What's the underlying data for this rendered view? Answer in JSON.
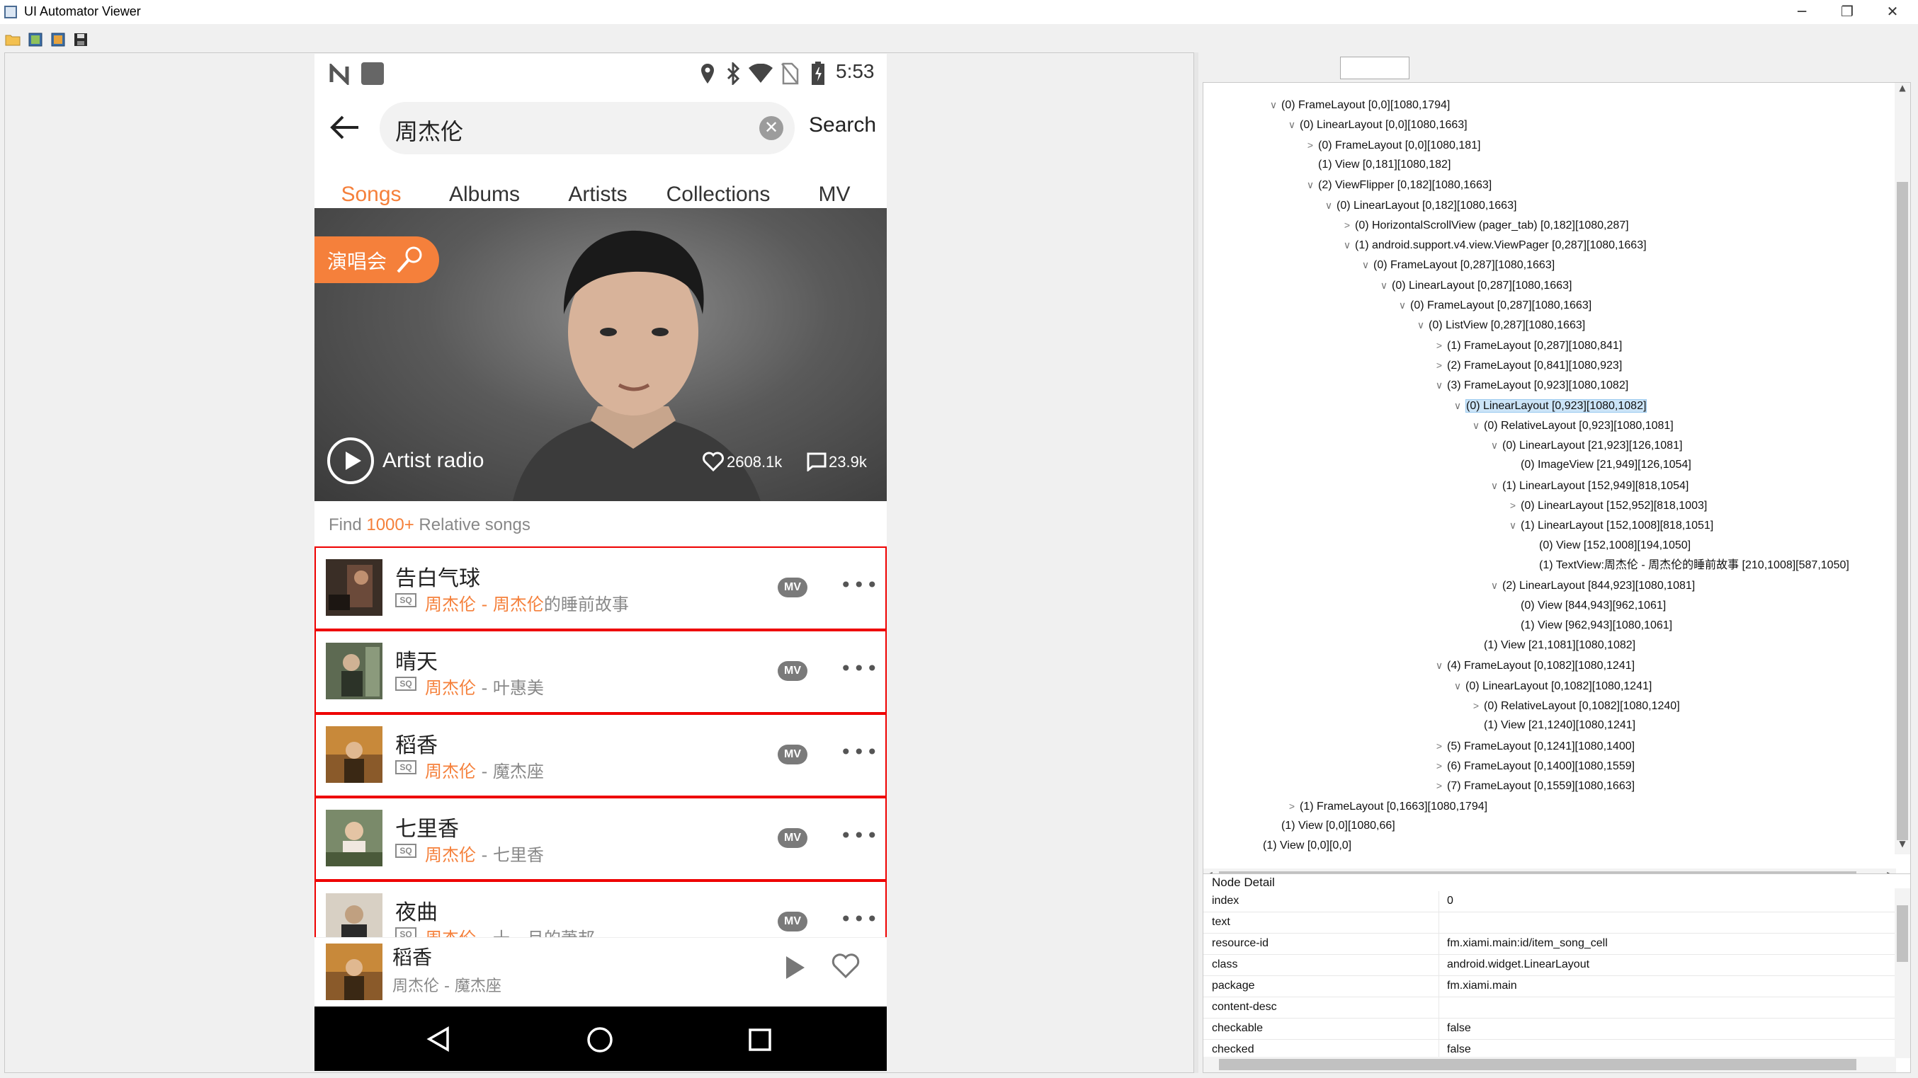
{
  "window": {
    "title": "UI Automator Viewer",
    "minimize": "─",
    "restore": "❐",
    "close": "✕"
  },
  "phone": {
    "status_time": "5:53",
    "search_query": "周杰伦",
    "search_button": "Search",
    "tabs": [
      "Songs",
      "Albums",
      "Artists",
      "Collections",
      "MV"
    ],
    "active_tab": "Songs",
    "banner": {
      "concert_tag": "演唱会",
      "radio_label": "Artist radio",
      "likes": "2608.1k",
      "comments": "23.9k"
    },
    "find": {
      "prefix": "Find ",
      "count": "1000+",
      "suffix": " Relative songs"
    },
    "songs": [
      {
        "title": "告白气球",
        "artist": "周杰伦",
        "sep": " - ",
        "artist2": "周杰伦",
        "album": "的睡前故事",
        "sq": "SQ",
        "mv": "MV"
      },
      {
        "title": "晴天",
        "artist": "周杰伦",
        "sep": " - ",
        "artist2": "",
        "album": "叶惠美",
        "sq": "SQ",
        "mv": "MV"
      },
      {
        "title": "稻香",
        "artist": "周杰伦",
        "sep": " - ",
        "artist2": "",
        "album": "魔杰座",
        "sq": "SQ",
        "mv": "MV"
      },
      {
        "title": "七里香",
        "artist": "周杰伦",
        "sep": " - ",
        "artist2": "",
        "album": "七里香",
        "sq": "SQ",
        "mv": "MV"
      },
      {
        "title": "夜曲",
        "artist": "周杰伦",
        "sep": " - ",
        "artist2": "",
        "album": "十一月的萧邦",
        "sq": "SQ",
        "mv": "MV"
      }
    ],
    "more_glyph": "•••",
    "mini_player": {
      "title": "稻香",
      "subtitle": "周杰伦 - 魔杰座"
    }
  },
  "tree": {
    "nodes": [
      {
        "depth": 0,
        "tw": "∨",
        "label": "(0) FrameLayout [0,0][1080,1794]"
      },
      {
        "depth": 1,
        "tw": "∨",
        "label": "(0) LinearLayout [0,0][1080,1663]"
      },
      {
        "depth": 2,
        "tw": ">",
        "label": "(0) FrameLayout [0,0][1080,181]"
      },
      {
        "depth": 2,
        "tw": "",
        "label": "(1) View [0,181][1080,182]"
      },
      {
        "depth": 2,
        "tw": "∨",
        "label": "(2) ViewFlipper [0,182][1080,1663]"
      },
      {
        "depth": 3,
        "tw": "∨",
        "label": "(0) LinearLayout [0,182][1080,1663]"
      },
      {
        "depth": 4,
        "tw": ">",
        "label": "(0) HorizontalScrollView (pager_tab) [0,182][1080,287]"
      },
      {
        "depth": 4,
        "tw": "∨",
        "label": "(1) android.support.v4.view.ViewPager [0,287][1080,1663]"
      },
      {
        "depth": 5,
        "tw": "∨",
        "label": "(0) FrameLayout [0,287][1080,1663]"
      },
      {
        "depth": 6,
        "tw": "∨",
        "label": "(0) LinearLayout [0,287][1080,1663]"
      },
      {
        "depth": 7,
        "tw": "∨",
        "label": "(0) FrameLayout [0,287][1080,1663]"
      },
      {
        "depth": 8,
        "tw": "∨",
        "label": "(0) ListView [0,287][1080,1663]"
      },
      {
        "depth": 9,
        "tw": ">",
        "label": "(1) FrameLayout [0,287][1080,841]"
      },
      {
        "depth": 9,
        "tw": ">",
        "label": "(2) FrameLayout [0,841][1080,923]"
      },
      {
        "depth": 9,
        "tw": "∨",
        "label": "(3) FrameLayout [0,923][1080,1082]"
      },
      {
        "depth": 10,
        "tw": "∨",
        "label": "(0) LinearLayout [0,923][1080,1082]",
        "selected": true
      },
      {
        "depth": 11,
        "tw": "∨",
        "label": "(0) RelativeLayout [0,923][1080,1081]"
      },
      {
        "depth": 12,
        "tw": "∨",
        "label": "(0) LinearLayout [21,923][126,1081]"
      },
      {
        "depth": 13,
        "tw": "",
        "label": "(0) ImageView [21,949][126,1054]"
      },
      {
        "depth": 12,
        "tw": "∨",
        "label": "(1) LinearLayout [152,949][818,1054]"
      },
      {
        "depth": 13,
        "tw": ">",
        "label": "(0) LinearLayout [152,952][818,1003]"
      },
      {
        "depth": 13,
        "tw": "∨",
        "label": "(1) LinearLayout [152,1008][818,1051]"
      },
      {
        "depth": 14,
        "tw": "",
        "label": "(0) View [152,1008][194,1050]"
      },
      {
        "depth": 14,
        "tw": "",
        "label": "(1) TextView:周杰伦 - 周杰伦的睡前故事 [210,1008][587,1050]"
      },
      {
        "depth": 12,
        "tw": "∨",
        "label": "(2) LinearLayout [844,923][1080,1081]"
      },
      {
        "depth": 13,
        "tw": "",
        "label": "(0) View [844,943][962,1061]"
      },
      {
        "depth": 13,
        "tw": "",
        "label": "(1) View [962,943][1080,1061]"
      },
      {
        "depth": 11,
        "tw": "",
        "label": "(1) View [21,1081][1080,1082]"
      },
      {
        "depth": 9,
        "tw": "∨",
        "label": "(4) FrameLayout [0,1082][1080,1241]"
      },
      {
        "depth": 10,
        "tw": "∨",
        "label": "(0) LinearLayout [0,1082][1080,1241]"
      },
      {
        "depth": 11,
        "tw": ">",
        "label": "(0) RelativeLayout [0,1082][1080,1240]"
      },
      {
        "depth": 11,
        "tw": "",
        "label": "(1) View [21,1240][1080,1241]"
      },
      {
        "depth": 9,
        "tw": ">",
        "label": "(5) FrameLayout [0,1241][1080,1400]"
      },
      {
        "depth": 9,
        "tw": ">",
        "label": "(6) FrameLayout [0,1400][1080,1559]"
      },
      {
        "depth": 9,
        "tw": ">",
        "label": "(7) FrameLayout [0,1559][1080,1663]"
      },
      {
        "depth": 1,
        "tw": ">",
        "label": "(1) FrameLayout [0,1663][1080,1794]"
      },
      {
        "depth": 0,
        "tw": "",
        "label": "(1) View [0,0][1080,66]"
      },
      {
        "depth": -1,
        "tw": "",
        "label": "(1) View [0,0][0,0]"
      }
    ]
  },
  "node_detail": {
    "title": "Node Detail",
    "rows": [
      {
        "key": "index",
        "value": "0"
      },
      {
        "key": "text",
        "value": ""
      },
      {
        "key": "resource-id",
        "value": "fm.xiami.main:id/item_song_cell"
      },
      {
        "key": "class",
        "value": "android.widget.LinearLayout"
      },
      {
        "key": "package",
        "value": "fm.xiami.main"
      },
      {
        "key": "content-desc",
        "value": ""
      },
      {
        "key": "checkable",
        "value": "false"
      },
      {
        "key": "checked",
        "value": "false"
      }
    ]
  },
  "colors": {
    "accent": "#f5803b",
    "highlight": "#e00000",
    "selection": "#cce4f7"
  }
}
